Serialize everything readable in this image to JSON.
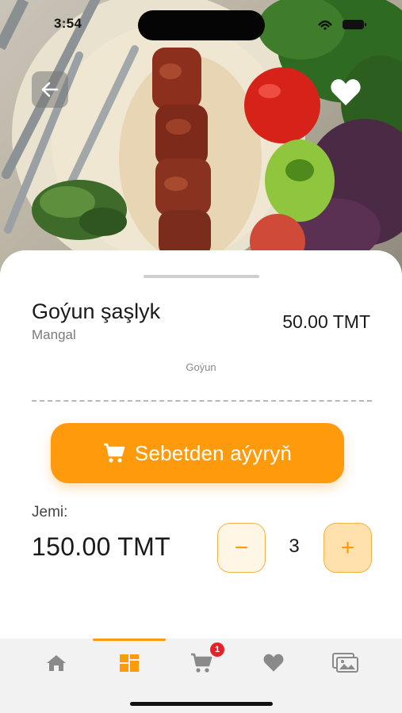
{
  "status_bar": {
    "time": "3:54"
  },
  "hero": {
    "image": "grilled-lamb-kebab-photo"
  },
  "header": {
    "back_icon": "arrow-left-icon",
    "favorite_icon": "heart-icon"
  },
  "product": {
    "name": "Goýun şaşlyk",
    "category": "Mangal",
    "price": "50.00 TMT",
    "ingredient": "Goýun"
  },
  "cart_button": {
    "label": "Sebetden aýyryň",
    "icon": "cart-icon"
  },
  "total": {
    "label": "Jemi:",
    "value": "150.00 TMT"
  },
  "quantity": {
    "minus": "−",
    "value": "3",
    "plus": "+"
  },
  "bottom_nav": {
    "items": [
      {
        "name": "home",
        "icon": "home-icon"
      },
      {
        "name": "categories",
        "icon": "grid-icon",
        "active": true
      },
      {
        "name": "cart",
        "icon": "cart-icon",
        "badge": "1"
      },
      {
        "name": "favorites",
        "icon": "heart-icon"
      },
      {
        "name": "gallery",
        "icon": "gallery-icon"
      }
    ]
  },
  "colors": {
    "accent": "#ff9a0d",
    "badge": "#e8202a",
    "nav_bg": "#f2f2f2"
  }
}
